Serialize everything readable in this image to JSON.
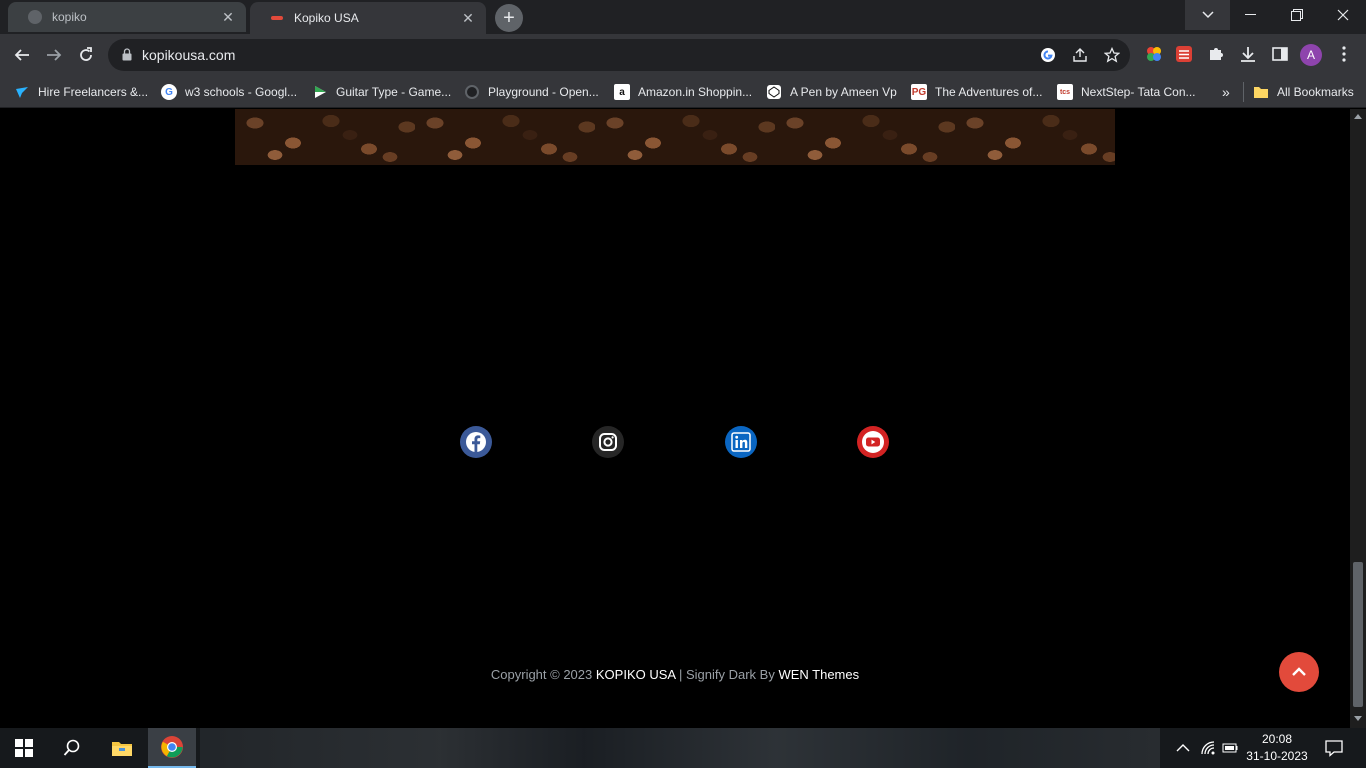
{
  "browser": {
    "tabs": [
      {
        "title": "kopiko",
        "active": false
      },
      {
        "title": "Kopiko USA",
        "active": true
      }
    ],
    "new_tab_icon": "plus-icon",
    "address": "kopikousa.com",
    "bookmarks": [
      {
        "label": "Hire Freelancers &...",
        "icon": "freelancer-icon"
      },
      {
        "label": "w3 schools - Googl...",
        "icon": "google-icon"
      },
      {
        "label": "Guitar Type - Game...",
        "icon": "game-icon"
      },
      {
        "label": "Playground - Open...",
        "icon": "openai-icon"
      },
      {
        "label": "Amazon.in Shoppin...",
        "icon": "amazon-icon"
      },
      {
        "label": "A Pen by Ameen Vp",
        "icon": "codepen-icon"
      },
      {
        "label": "The Adventures of...",
        "icon": "pg-icon"
      },
      {
        "label": "NextStep- Tata Con...",
        "icon": "tcs-icon"
      }
    ],
    "all_bookmarks": "All Bookmarks",
    "profile_initial": "A"
  },
  "page": {
    "social": [
      {
        "name": "facebook",
        "icon": "facebook-icon"
      },
      {
        "name": "instagram",
        "icon": "instagram-icon"
      },
      {
        "name": "linkedin",
        "icon": "linkedin-icon"
      },
      {
        "name": "youtube",
        "icon": "youtube-icon"
      }
    ],
    "footer": {
      "prefix": "Copyright © 2023 ",
      "site": "KOPIKO USA",
      "middle": " | Signify Dark By ",
      "theme_author": "WEN Themes"
    },
    "accent": "#e24a3b"
  },
  "taskbar": {
    "time": "20:08",
    "date": "31-10-2023"
  }
}
